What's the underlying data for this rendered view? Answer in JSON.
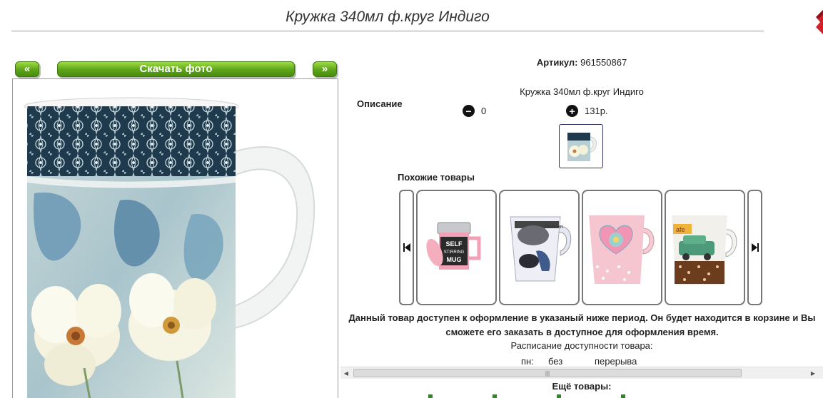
{
  "page": {
    "title": "Кружка 340мл ф.круг Индиго"
  },
  "gallery": {
    "prev_label": "«",
    "download_label": "Скачать фото",
    "next_label": "»"
  },
  "product": {
    "sku_label": "Артикул:",
    "sku_value": "961550867",
    "description_label": "Описание",
    "name": "Кружка 340мл ф.круг Индиго",
    "quantity": "0",
    "price": "131р."
  },
  "similar": {
    "title": "Похожие товары",
    "items": [
      {
        "icon": "self-stirring-mug",
        "text": "SELF STIRRING MUG"
      },
      {
        "icon": "fashion-mug",
        "text": ""
      },
      {
        "icon": "heart-mug",
        "text": ""
      },
      {
        "icon": "car-coffee-mug",
        "text": ""
      }
    ]
  },
  "availability": {
    "notice": "Данный товар доступен к оформление в указаный ниже период. Он будет находится в корзине и Вы сможете его заказать в доступное для оформления время.",
    "schedule_label": "Расписание доступности товара:",
    "day": "пн:",
    "value_a": "без",
    "value_b": "перерыва"
  },
  "more": {
    "title": "Ещё товары:"
  },
  "colors": {
    "accent_green": "#5ca31a",
    "marker_red": "#d0202a"
  }
}
